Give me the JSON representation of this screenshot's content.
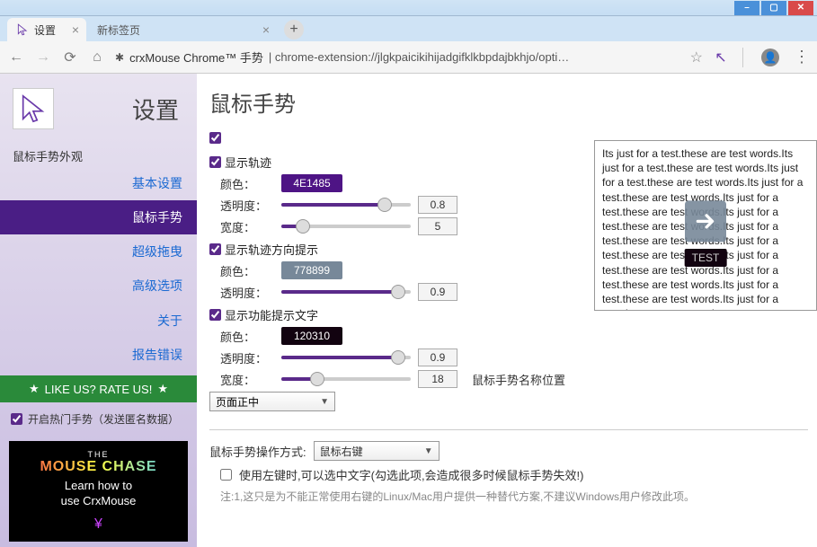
{
  "window": {
    "min": "–",
    "max": "▢",
    "close": "✕"
  },
  "tabs": {
    "active": "设置",
    "inactive": "新标签页",
    "new": "+"
  },
  "toolbar": {
    "back": "←",
    "fwd": "→",
    "reload": "⟳",
    "home": "⌂",
    "title_dark": "crxMouse Chrome™ 手势",
    "url_rest": "chrome-extension://jlgkpaicikihijadgifklkbpdajbkhjo/opti…",
    "star": "☆",
    "cursor": "↖",
    "kebab": "⋮"
  },
  "sidebar": {
    "title": "设置",
    "section": "鼠标手势外观",
    "items": [
      {
        "id": "basic",
        "label": "基本设置"
      },
      {
        "id": "gesture",
        "label": "鼠标手势"
      },
      {
        "id": "super",
        "label": "超级拖曳"
      },
      {
        "id": "advanced",
        "label": "高级选项"
      },
      {
        "id": "about",
        "label": "关于"
      },
      {
        "id": "report",
        "label": "报告错误"
      }
    ],
    "rate": "LIKE US? RATE US!",
    "toggle": "开启热门手势（发送匿名数据）",
    "promo": {
      "t1": "THE",
      "t2": "MOUSE CHASE",
      "t3a": "Learn how to",
      "t3b": "use CrxMouse"
    }
  },
  "content": {
    "title": "鼠标手势",
    "labels": {
      "color": "颜色：",
      "opacity": "透明度：",
      "width": "宽度："
    },
    "groups": [
      {
        "chk": "显示轨迹",
        "color": "4E1485",
        "colorBg": "#4E1485",
        "opacity": "0.8",
        "opacityPct": 80,
        "width": "5",
        "widthPct": 17
      },
      {
        "chk": "显示轨迹方向提示",
        "color": "778899",
        "colorBg": "#778899",
        "opacity": "0.9",
        "opacityPct": 90
      },
      {
        "chk": "显示功能提示文字",
        "color": "120310",
        "colorBg": "#120310",
        "opacity": "0.9",
        "opacityPct": 90,
        "width": "18",
        "widthPct": 28,
        "posLabel": "鼠标手势名称位置",
        "posValue": "页面正中"
      }
    ],
    "bottom": {
      "methodLabel": "鼠标手势操作方式:",
      "methodValue": "鼠标右键",
      "leftClick": "使用左键时,可以选中文字(勾选此项,会造成很多时候鼠标手势失效!)",
      "note1": "注:1,这只是为不能正常使用右键的Linux/Mac用户提供一种替代方案,不建议Windows用户修改此项。"
    }
  },
  "preview": {
    "text": "Its just for a test.these are test words.Its just for a test.these are test words.Its just for a test.these are test words.Its just for a test.these are test words.Its just for a test.these are test words.Its just for a test.these are test words.Its just for a test.these are test words.Its just for a test.these are test words.Its just for a test.these are test words.Its just for a test.these are test words.Its just for a test.these are test words.Its just for a test.these are test words.",
    "label": "TEST"
  }
}
